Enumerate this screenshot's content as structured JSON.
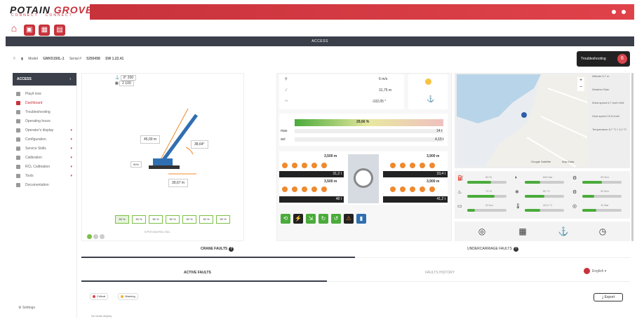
{
  "brand": {
    "logo_part1": "POTAIN",
    "logo_part2": "GROVE",
    "sub1": "CONNECT",
    "sub2": "CONNECT"
  },
  "header": {
    "title": "ACCESS"
  },
  "infobar": {
    "model_label": "Model",
    "model": "GMK5150L-1",
    "serial_label": "Serial #",
    "serial": "5250458",
    "version": "SW 1.22.41"
  },
  "troubleshooting": {
    "label": "Troubleshooting",
    "count": "6"
  },
  "sidebar": {
    "title": "ACCESS",
    "items": [
      {
        "label": "Playit now"
      },
      {
        "label": "Dashboard"
      },
      {
        "label": "Troubleshooting"
      },
      {
        "label": "Operating hours"
      },
      {
        "label": "Operator's display"
      },
      {
        "label": "Configuration"
      },
      {
        "label": "Service Skills"
      },
      {
        "label": "Calibration"
      },
      {
        "label": "RCL Calibration"
      },
      {
        "label": "Tools"
      },
      {
        "label": "Documentation"
      }
    ],
    "settings": "Settings"
  },
  "crane": {
    "top_val1": "0° 200",
    "top_val2": "2 100",
    "boom_length": "45,00 m",
    "angle": "38,64°",
    "radius": "39,67 m",
    "pct_label": "90%",
    "footer": "0 POT.444 RCL SCL",
    "tabs": [
      "50 %",
      "50 %",
      "50 %",
      "50 %",
      "50 %",
      "50 %",
      "50 %"
    ]
  },
  "status": {
    "wind": "6 m/s",
    "height": "31,75 m",
    "slew": "-102,05 °",
    "load_pct": "29,66 %",
    "max_label": "max",
    "act_label": "act",
    "max_val": "14 t",
    "act_val": "4,15 t",
    "outriggers": {
      "fl_top": "3,500 m",
      "fr_top": "3,900 m",
      "fl_pressure": "31,2 t",
      "fr_pressure": "33,4 t",
      "rl_top": "3,500 m",
      "rr_top": "3,900 m",
      "rl_pressure": "48 t",
      "rr_pressure": "41,2 t"
    }
  },
  "mapinfo": {
    "items": [
      "Altitude 6,7 m",
      "Weather Rain",
      "Wind speed 6,7 km/h NW",
      "Gust speed 19,5 km/h",
      "Temperature 6,7 °C / 1,0 °C"
    ],
    "map_label": "Google Satellite",
    "map_tag": "Map Data"
  },
  "gauges": [
    {
      "label": "60 %",
      "fill": 0.6
    },
    {
      "label": "800 bar",
      "fill": 0.4
    },
    {
      "label": "30 Nm",
      "fill": 0.5
    },
    {
      "label": "70 %",
      "fill": 0.7
    },
    {
      "label": "50 °C",
      "fill": 0.5
    },
    {
      "label": "30 Nm",
      "fill": 0.3
    },
    {
      "label": "20 km",
      "fill": 0.2
    },
    {
      "label": "40,0 °C",
      "fill": 0.4
    },
    {
      "label": "11 Bar",
      "fill": 0.35
    }
  ],
  "faults": {
    "tab_crane": "CRANE FAULTS",
    "tab_undercarriage": "UNDERCARRIAGE FAULTS",
    "tab_active": "ACTIVE FAULTS",
    "tab_history": "FAULTS HISTORY",
    "language": "English",
    "critical": "Critical",
    "warning": "Warning",
    "export": "Export",
    "none": "No faults display"
  },
  "colors": {
    "brand_red": "#c8323b",
    "dark": "#3a3f4a",
    "green": "#4aab3a",
    "orange": "#f0892e"
  }
}
